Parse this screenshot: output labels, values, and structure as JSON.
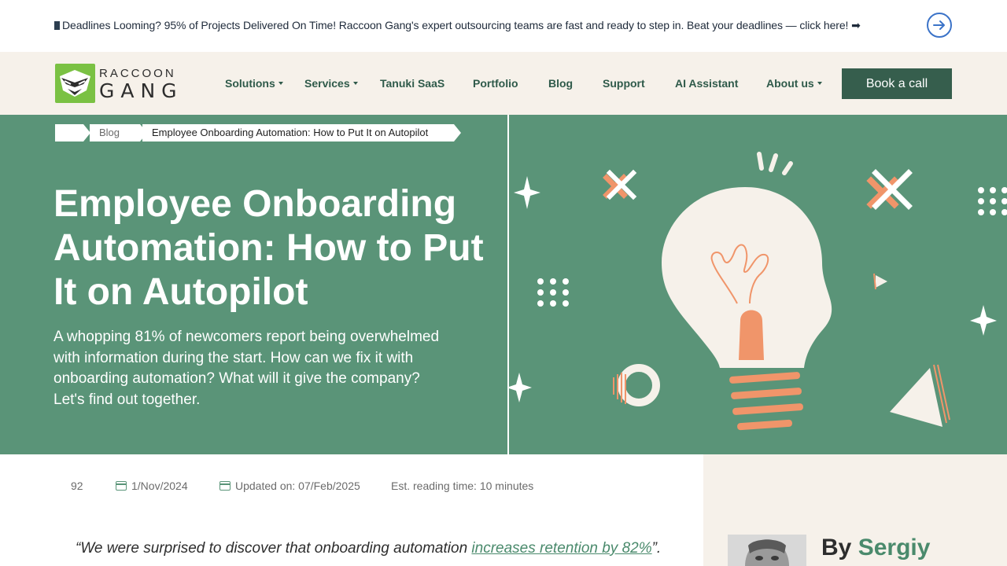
{
  "announcement": {
    "text": "Deadlines Looming? 95% of Projects Delivered On Time! Raccoon Gang's expert outsourcing teams are fast and ready to step in. Beat your deadlines — click here! ➡"
  },
  "logo": {
    "line1": "RACCOON",
    "line2": "GANG"
  },
  "nav": {
    "items": [
      {
        "label": "Solutions",
        "dropdown": true
      },
      {
        "label": "Services",
        "dropdown": true
      },
      {
        "label": "Tanuki SaaS",
        "dropdown": false
      },
      {
        "label": "Portfolio",
        "dropdown": false
      },
      {
        "label": "Blog",
        "dropdown": false
      },
      {
        "label": "Support",
        "dropdown": false
      },
      {
        "label": "AI Assistant",
        "dropdown": false
      },
      {
        "label": "About us",
        "dropdown": true
      }
    ],
    "cta": "Book a call"
  },
  "breadcrumb": {
    "items": [
      "Blog",
      "Employee Onboarding Automation: How to Put It on Autopilot"
    ]
  },
  "hero": {
    "title": "Employee Onboarding Automation: How to Put It on Autopilot",
    "description": "A whopping 81% of newcomers report being overwhelmed with information during the start. How can we fix it with onboarding automation? What will it give the company? Let's find out together."
  },
  "meta": {
    "views": "92",
    "published": "1/Nov/2024",
    "updated": "Updated on: 07/Feb/2025",
    "reading_time": "Est. reading time: 10 minutes"
  },
  "quote": {
    "before": "“We were surprised to discover that onboarding automation ",
    "link": "increases retention by 82%",
    "after": "”."
  },
  "author": {
    "by": "By",
    "name": "Sergiy"
  },
  "colors": {
    "brand_green": "#5a9478",
    "dark_green": "#365e4d",
    "cream": "#f6f1ea",
    "orange": "#f0956a",
    "logo_green": "#7ac143"
  }
}
